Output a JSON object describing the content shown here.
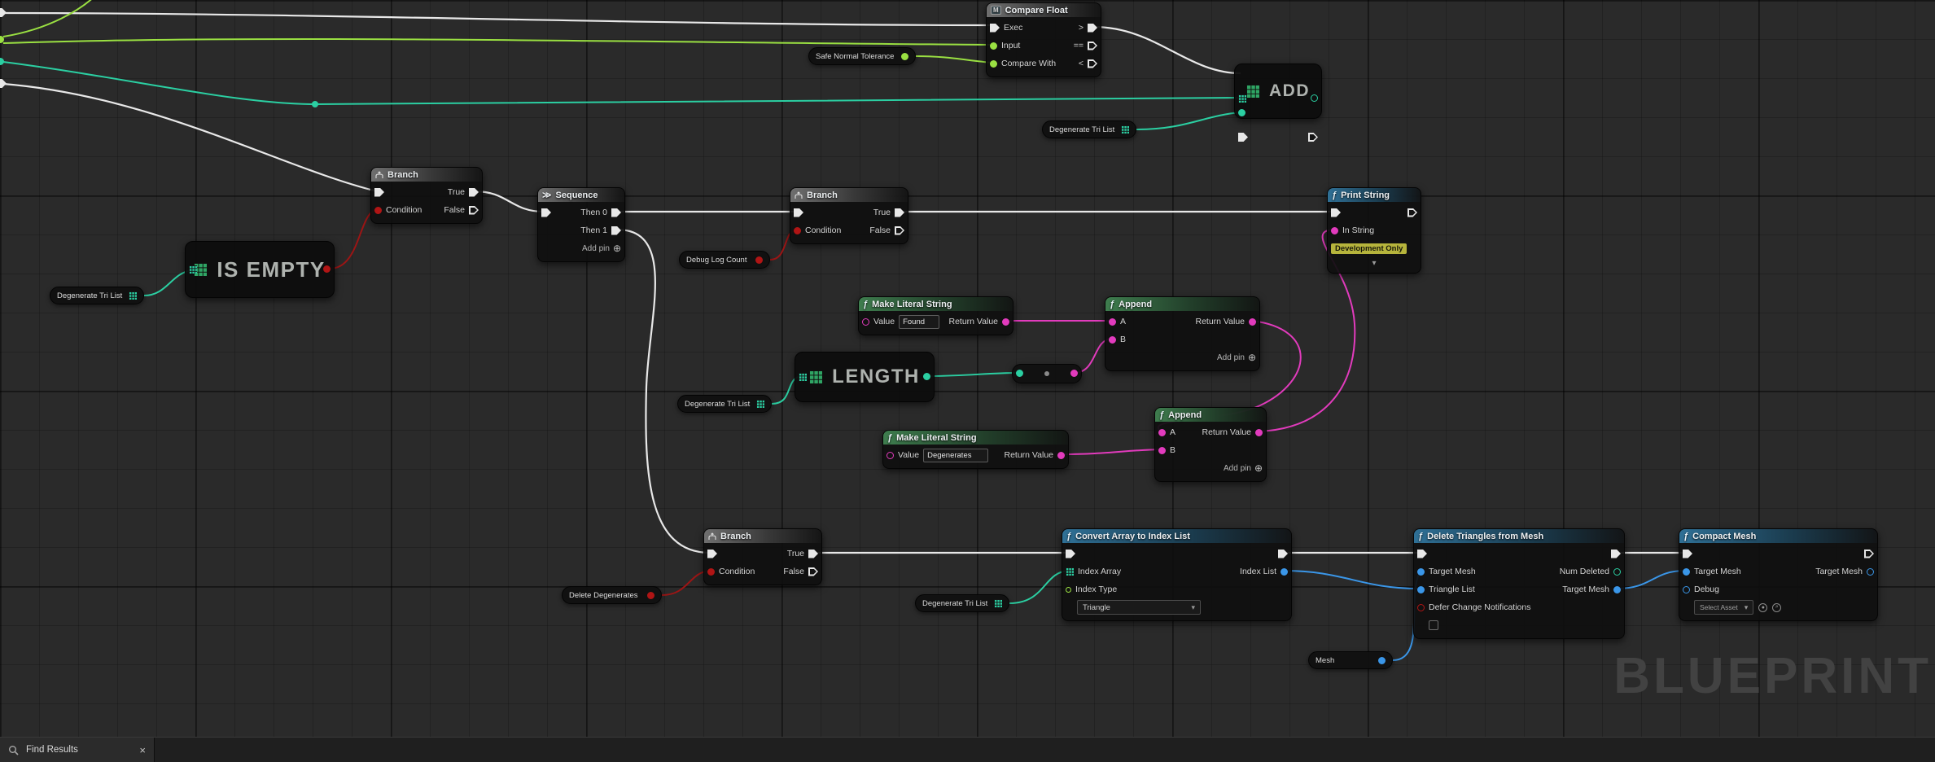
{
  "watermark": "BLUEPRINT",
  "bottom_bar": {
    "tab_label": "Find Results",
    "close": "×"
  },
  "icons": {
    "function": "ƒ",
    "macro": "M",
    "sequence": "≫",
    "add_pin": "⊕",
    "chevron": "▾",
    "dev_chevron": "▾"
  },
  "pills": {
    "safe_normal_tolerance": {
      "label": "Safe Normal Tolerance"
    },
    "degenerate_tri_list": {
      "label": "Degenerate Tri List"
    },
    "debug_log_count": {
      "label": "Debug Log Count"
    },
    "delete_degenerates": {
      "label": "Delete Degenerates"
    },
    "mesh": {
      "label": "Mesh"
    }
  },
  "nodes": {
    "compare_float": {
      "title": "Compare Float",
      "exec_label": "Exec",
      "input_label": "Input",
      "compare_label": "Compare With",
      "out_gt": ">",
      "out_eq": "==",
      "out_lt": "<"
    },
    "add": {
      "label": "ADD"
    },
    "is_empty": {
      "label": "IS EMPTY"
    },
    "length": {
      "label": "LENGTH"
    },
    "branch": {
      "title": "Branch",
      "condition_label": "Condition",
      "true_label": "True",
      "false_label": "False"
    },
    "sequence": {
      "title": "Sequence",
      "then0_label": "Then 0",
      "then1_label": "Then 1",
      "add_pin_label": "Add pin"
    },
    "print_string": {
      "title": "Print String",
      "in_string_label": "In String",
      "dev_only_label": "Development Only"
    },
    "make_literal_found": {
      "title": "Make Literal String",
      "value_label": "Value",
      "value": "Found",
      "return_label": "Return Value"
    },
    "make_literal_degenerates": {
      "title": "Make Literal String",
      "value_label": "Value",
      "value": "Degenerates",
      "return_label": "Return Value"
    },
    "append": {
      "title": "Append",
      "a_label": "A",
      "b_label": "B",
      "return_label": "Return Value",
      "add_pin_label": "Add pin"
    },
    "convert": {
      "title": "Convert Array to Index List",
      "index_array_label": "Index Array",
      "index_type_label": "Index Type",
      "index_type_value": "Triangle",
      "index_list_label": "Index List"
    },
    "delete_triangles": {
      "title": "Delete Triangles from Mesh",
      "target_mesh_label": "Target Mesh",
      "triangle_list_label": "Triangle List",
      "defer_label": "Defer Change Notifications",
      "num_deleted_label": "Num Deleted",
      "target_mesh_out_label": "Target Mesh"
    },
    "compact_mesh": {
      "title": "Compact Mesh",
      "target_mesh_label": "Target Mesh",
      "debug_label": "Debug",
      "select_asset_label": "Select Asset",
      "target_mesh_out_label": "Target Mesh"
    }
  },
  "colors": {
    "exec": "#e8e8e8",
    "float": "#9ae042",
    "bool": "#b01515",
    "string": "#e23bbd",
    "int_array": "#2bcfa2",
    "object": "#3a96e8"
  }
}
